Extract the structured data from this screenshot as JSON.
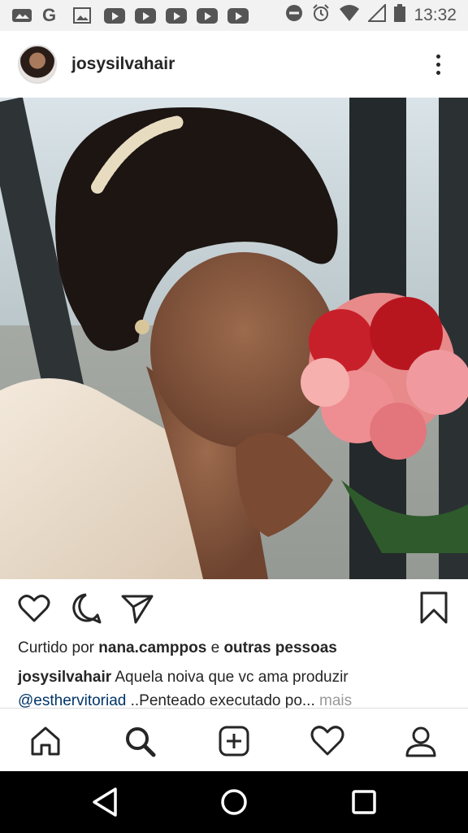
{
  "status_bar": {
    "time": "13:32",
    "icons": [
      "image-icon",
      "google-icon",
      "gallery-icon",
      "youtube-icon",
      "youtube-icon",
      "youtube-icon",
      "youtube-icon",
      "youtube-icon",
      "dnd-icon",
      "alarm-icon",
      "wifi-icon",
      "signal-icon",
      "battery-icon"
    ]
  },
  "post": {
    "username": "josysilvahair",
    "liked_by_prefix": "Curtido por ",
    "liked_by_user": "nana.camppos",
    "liked_by_joiner": " e ",
    "liked_by_others": "outras pessoas",
    "caption_user": "josysilvahair",
    "caption_text": " Aquela noiva que vc ama produzir",
    "caption_tag": "@esthervitoriad",
    "caption_text2": " ..Penteado executado po...",
    "caption_more": " mais"
  },
  "bottom_nav": [
    "home-icon",
    "search-icon",
    "new-post-icon",
    "activity-heart-icon",
    "profile-icon"
  ],
  "android_nav": [
    "back-icon",
    "home-circle-icon",
    "recents-icon"
  ],
  "colors": {
    "text": "#262626",
    "link": "#003569",
    "muted": "#999999"
  }
}
